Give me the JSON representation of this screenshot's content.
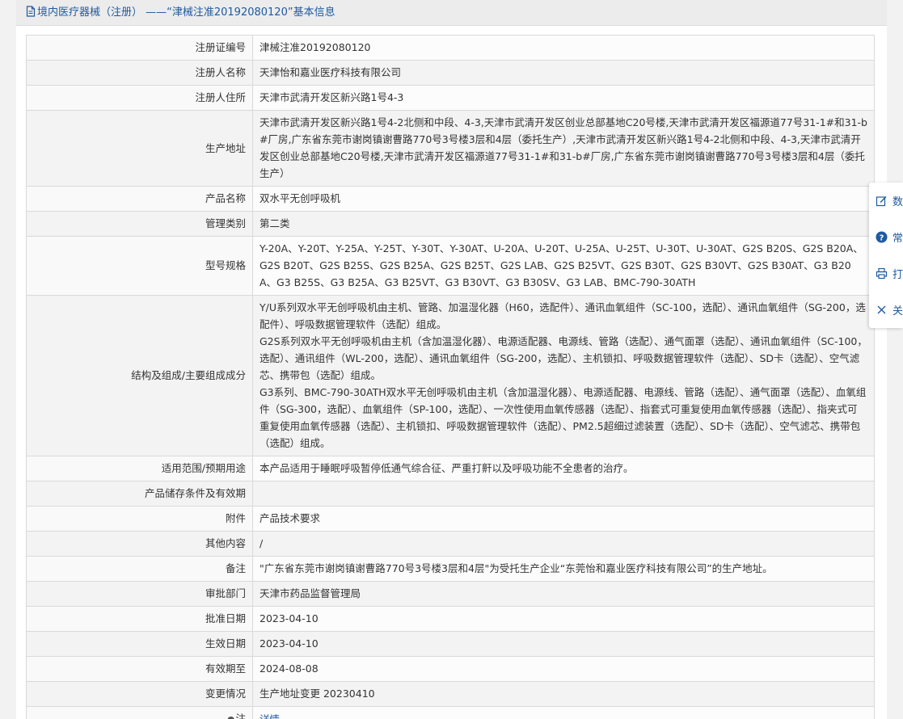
{
  "header": {
    "title": "境内医疗器械（注册）  ——“津械注准20192080120”基本信息"
  },
  "rows": [
    {
      "label": "注册证编号",
      "value": "津械注准20192080120"
    },
    {
      "label": "注册人名称",
      "value": "天津怡和嘉业医疗科技有限公司"
    },
    {
      "label": "注册人住所",
      "value": "天津市武清开发区新兴路1号4-3"
    },
    {
      "label": "生产地址",
      "value": "天津市武清开发区新兴路1号4-2北侧和中段、4-3,天津市武清开发区创业总部基地C20号楼,天津市武清开发区福源道77号31-1#和31-b#厂房,广东省东莞市谢岗镇谢曹路770号3号楼3层和4层（委托生产）,天津市武清开发区新兴路1号4-2北侧和中段、4-3,天津市武清开发区创业总部基地C20号楼,天津市武清开发区福源道77号31-1#和31-b#厂房,广东省东莞市谢岗镇谢曹路770号3号楼3层和4层（委托生产）"
    },
    {
      "label": "产品名称",
      "value": "双水平无创呼吸机"
    },
    {
      "label": "管理类别",
      "value": "第二类"
    },
    {
      "label": "型号规格",
      "value": "Y-20A、Y-20T、Y-25A、Y-25T、Y-30T、Y-30AT、U-20A、U-20T、U-25A、U-25T、U-30T、U-30AT、G2S B20S、G2S B20A、G2S B20T、G2S B25S、G2S B25A、G2S B25T、G2S LAB、G2S B25VT、G2S B30T、G2S B30VT、G2S B30AT、G3 B20A、G3 B25S、G3 B25A、G3 B25VT、G3 B30VT、G3 B30SV、G3 LAB、BMC-790-30ATH"
    },
    {
      "label": "结构及组成/主要组成成分",
      "paragraphs": [
        "Y/U系列双水平无创呼吸机由主机、管路、加温湿化器（H60，选配件）、通讯血氧组件（SC-100，选配）、通讯血氧组件（SG-200，选配件）、呼吸数据管理软件（选配）组成。",
        "G2S系列双水平无创呼吸机由主机（含加温湿化器）、电源适配器、电源线、管路（选配）、通气面罩（选配）、通讯血氧组件（SC-100，选配）、通讯组件（WL-200，选配）、通讯血氧组件（SG-200，选配）、主机锁扣、呼吸数据管理软件（选配）、SD卡（选配）、空气滤芯、携带包（选配）组成。",
        "G3系列、BMC-790-30ATH双水平无创呼吸机由主机（含加温湿化器）、电源适配器、电源线、管路（选配）、通气面罩（选配）、血氧组件（SG-300，选配）、血氧组件（SP-100，选配）、一次性使用血氧传感器（选配）、指套式可重复使用血氧传感器（选配）、指夹式可重复使用血氧传感器（选配）、主机锁扣、呼吸数据管理软件（选配）、PM2.5超细过滤装置（选配）、SD卡（选配）、空气滤芯、携带包（选配）组成。"
      ]
    },
    {
      "label": "适用范围/预期用途",
      "value": "本产品适用于睡眠呼吸暂停低通气综合征、严重打鼾以及呼吸功能不全患者的治疗。"
    },
    {
      "label": "产品储存条件及有效期",
      "value": ""
    },
    {
      "label": "附件",
      "value": "产品技术要求"
    },
    {
      "label": "其他内容",
      "value": "/"
    },
    {
      "label": "备注",
      "value": "\"广东省东莞市谢岗镇谢曹路770号3号楼3层和4层\"为受托生产企业“东莞怡和嘉业医疗科技有限公司”的生产地址。"
    },
    {
      "label": "审批部门",
      "value": "天津市药品监督管理局"
    },
    {
      "label": "批准日期",
      "value": "2023-04-10"
    },
    {
      "label": "生效日期",
      "value": "2023-04-10"
    },
    {
      "label": "有效期至",
      "value": "2024-08-08"
    },
    {
      "label": "变更情况",
      "value": "生产地址变更 20230410"
    },
    {
      "label": "注",
      "value": "详情"
    }
  ],
  "floatbar": {
    "items": [
      {
        "icon": "edit-icon",
        "label": "数"
      },
      {
        "icon": "help-circle-icon",
        "label": "常"
      },
      {
        "icon": "printer-icon",
        "label": "打"
      },
      {
        "icon": "close-icon",
        "label": "关"
      }
    ]
  }
}
